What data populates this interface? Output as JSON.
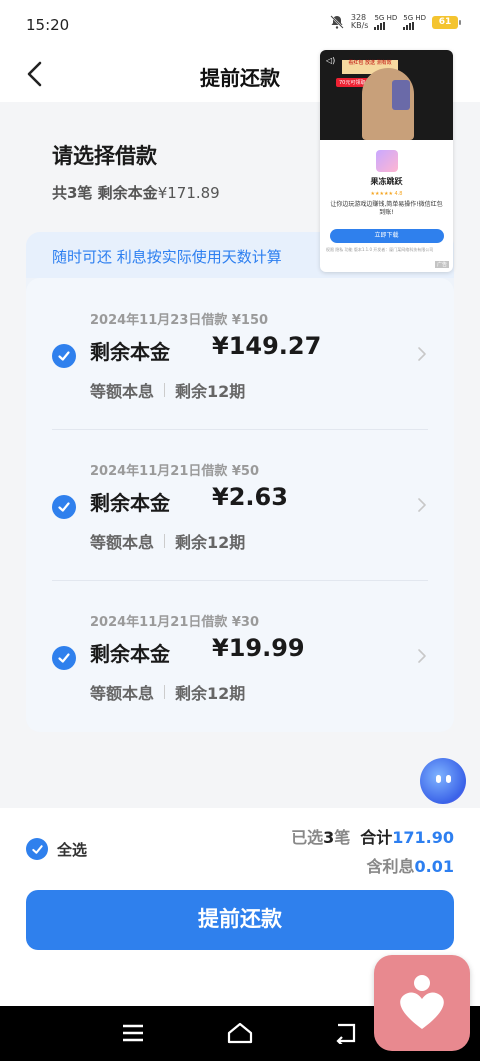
{
  "status_bar": {
    "time": "15:20",
    "net_speed_value": "328",
    "net_speed_unit": "KB/s",
    "signal1": "5G HD",
    "signal2": "5G HD",
    "battery": "61"
  },
  "header": {
    "title": "提前还款",
    "back_icon": "chevron-left-icon"
  },
  "section": {
    "title": "请选择借款",
    "summary_count": "共3笔",
    "summary_label": "剩余本金",
    "summary_amount": "¥171.89"
  },
  "banner": "随时可还 利息按实际使用天数计算",
  "loans": [
    {
      "date": "2024年11月23日借款 ¥150",
      "label": "剩余本金",
      "amount": "¥149.27",
      "method": "等额本息",
      "periods": "剩余12期",
      "checked": true
    },
    {
      "date": "2024年11月21日借款 ¥50",
      "label": "剩余本金",
      "amount": "¥2.63",
      "method": "等额本息",
      "periods": "剩余12期",
      "checked": true
    },
    {
      "date": "2024年11月21日借款 ¥30",
      "label": "剩余本金",
      "amount": "¥19.99",
      "method": "等额本息",
      "periods": "剩余12期",
      "checked": true
    }
  ],
  "ad": {
    "banner_text": "看红包 放送 测有效",
    "tag": "70元可领取红包",
    "app_name": "果冻跳跃",
    "rating": "★★★★★ 4.8",
    "desc": "让你边玩游戏边赚钱,简单易操作!微信红包到账!",
    "cta": "立即下载",
    "footer": "权限 隐私 功能 版本1.1.0 开发者：厦门某网络科技有限公司",
    "badge": "广告"
  },
  "footer": {
    "select_all": "全选",
    "selected_prefix": "已选",
    "selected_count": "3",
    "selected_suffix": "笔",
    "total_label": "合计",
    "total_value": "171.90",
    "interest_label": "含利息",
    "interest_value": "0.01",
    "submit": "提前还款"
  },
  "colors": {
    "accent": "#2f80ed",
    "link": "#2d7ff0",
    "background": "#f4f5f7",
    "heart_badge": "#e8898f"
  }
}
